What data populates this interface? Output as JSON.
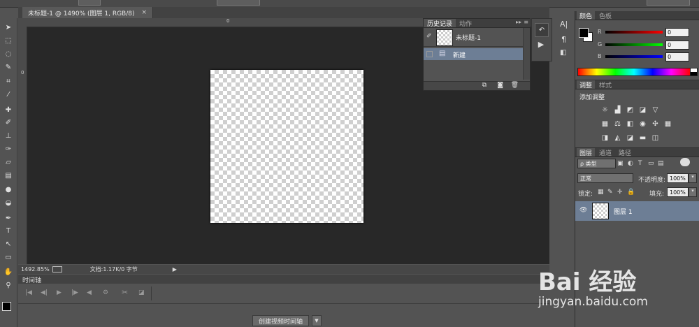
{
  "document_tab": {
    "title": "未标题-1 @ 1490% (图层 1, RGB/8)",
    "close": "×"
  },
  "rulers": {
    "h_zero": "0",
    "v_zero": "0"
  },
  "status": {
    "zoom": "1492.85%",
    "doc_info": "文档:1.17K/0 字节"
  },
  "timeline": {
    "tab": "时间轴",
    "create_button": "创建视频时间轴"
  },
  "history_panel": {
    "tabs": [
      "历史记录",
      "动作"
    ],
    "snapshot_label": "未标题-1",
    "items": [
      {
        "label": "新建"
      }
    ]
  },
  "color_panel": {
    "tabs": [
      "颜色",
      "色板"
    ],
    "channels": [
      {
        "label": "R",
        "value": "0",
        "color": "#ff0000"
      },
      {
        "label": "G",
        "value": "0",
        "color": "#00ff00"
      },
      {
        "label": "B",
        "value": "0",
        "color": "#0000ff"
      }
    ]
  },
  "adjustments_panel": {
    "tabs": [
      "调整",
      "样式"
    ],
    "heading": "添加调整"
  },
  "layers_panel": {
    "tabs": [
      "图层",
      "通道",
      "路径"
    ],
    "filter_kind": "ρ 类型",
    "blend_mode": "正常",
    "opacity_label": "不透明度:",
    "opacity_value": "100%",
    "lock_label": "锁定:",
    "fill_label": "填充:",
    "fill_value": "100%",
    "layers": [
      {
        "name": "图层 1",
        "visible": true
      }
    ]
  },
  "watermark": {
    "logo": "Bai 经验",
    "url": "jingyan.baidu.com"
  },
  "colors": {
    "selection": "#6d7e95",
    "canvas_bg": "#282828",
    "ui_bg": "#535353"
  }
}
